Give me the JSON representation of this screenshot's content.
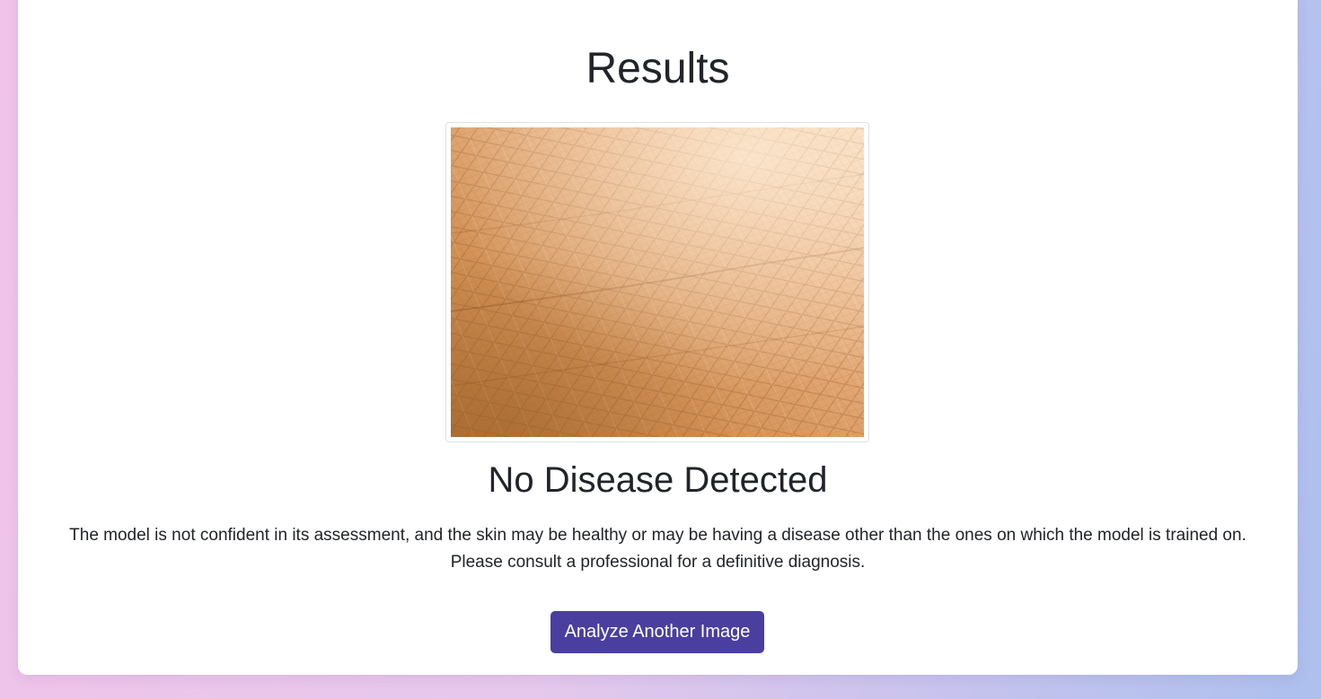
{
  "results": {
    "title": "Results",
    "image": {
      "icon": "skin-closeup-photo"
    },
    "verdict": "No Disease Detected",
    "note_lines": [
      "The model is not confident in its assessment, and the skin may be healthy or may be having a disease other than the ones on which the model is trained on.",
      "Please consult a professional for a definitive diagnosis."
    ],
    "button_label": "Analyze Another Image"
  },
  "colors": {
    "button": "#4a3f9f",
    "background_left": "#f1c3ea",
    "background_right": "#adc0ee",
    "card": "#ffffff",
    "text": "#212529"
  }
}
